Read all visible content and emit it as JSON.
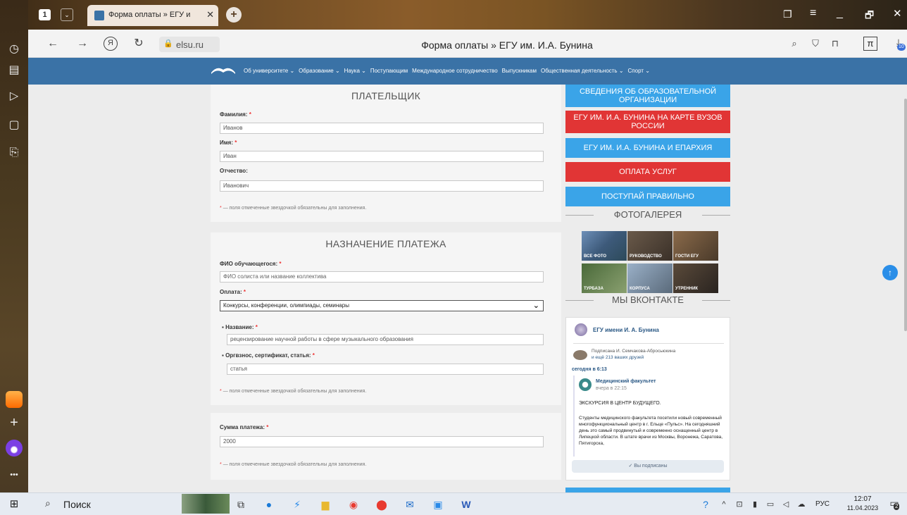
{
  "browser": {
    "tab_count": "1",
    "tab_title": "Форма оплаты » ЕГУ и",
    "address": "elsu.ru",
    "page_title": "Форма оплаты » ЕГУ им. И.А. Бунина",
    "ext_badge": "10"
  },
  "site_menu": [
    "Об университете ⌄",
    "Образование ⌄",
    "Наука ⌄",
    "Поступающим",
    "Международное сотрудничество",
    "Выпускникам",
    "Общественная деятельность ⌄",
    "Спорт ⌄"
  ],
  "payer": {
    "title": "ПЛАТЕЛЬЩИК",
    "surname_label": "Фамилия:",
    "surname_value": "Иванов",
    "name_label": "Имя:",
    "name_value": "Иван",
    "patronymic_label": "Отчество:",
    "patronymic_value": "Иванович",
    "note": "— поля отмеченные звездочкой обязательны для заполнения."
  },
  "purpose": {
    "title": "НАЗНАЧЕНИЕ ПЛАТЕЖА",
    "student_label": "ФИО обучающегося:",
    "student_placeholder": "ФИО солиста или название коллектива",
    "payment_label": "Оплата:",
    "payment_value": "Конкурсы, конференции, олимпиады, семинары",
    "name_label": "Название:",
    "name_value": "рецензирование научной работы в сфере музыкального образования",
    "fee_label": "Оргвзнос, сертификат, статья:",
    "fee_value": "статья",
    "note": "— поля отмеченные звездочкой обязательны для заполнения."
  },
  "amount": {
    "label": "Сумма платежа:",
    "value": "2000",
    "note": "— поля отмеченные звездочкой обязательны для заполнения."
  },
  "sidebar": {
    "btn1": "СВЕДЕНИЯ ОБ ОБРАЗОВАТЕЛЬНОЙ ОРГАНИЗАЦИИ",
    "btn2": "ЕГУ ИМ. И.А. БУНИНА НА КАРТЕ ВУЗОВ РОССИИ",
    "btn3": "ЕГУ ИМ. И.А. БУНИНА И ЕПАРХИЯ",
    "btn4": "ОПЛАТА УСЛУГ",
    "btn5": "ПОСТУПАЙ ПРАВИЛЬНО",
    "gallery_title": "ФОТОГАЛЕРЕЯ",
    "gallery": [
      "ВСЕ ФОТО",
      "РУКОВОДСТВО",
      "ГОСТИ ЕГУ",
      "ТУРБАЗА",
      "КОРПУСА",
      "УТРЕННИК"
    ],
    "vk_title": "МЫ ВКОНТАКТЕ"
  },
  "vk": {
    "group_name": "ЕГУ имени И. А. Бунина",
    "subscribed_by": "Подписана И. Семчакова-Абросьюкина",
    "friends": "и ещё 213 ваших друзей",
    "post_time": "сегодня в 6:13",
    "repost_author": "Медицинский факультет",
    "repost_time": "вчера в 22:15",
    "headline": "ЭКСКУРСИЯ В ЦЕНТР БУДУЩЕГО.",
    "body": "Студенты медицинского факультета посетили новый современный многофункциональный центр в г. Ельце «Пульс». На сегодняшний день это самый продвинутый и современно оснащенный центр в Липецкой области. В штате врачи из Москвы, Воронежа, Саратова, Пятигорска,",
    "subscribed": "✓ Вы подписаны"
  },
  "taskbar": {
    "search": "Поиск",
    "lang": "РУС",
    "time": "12:07",
    "date": "11.04.2023",
    "notif": "2"
  }
}
